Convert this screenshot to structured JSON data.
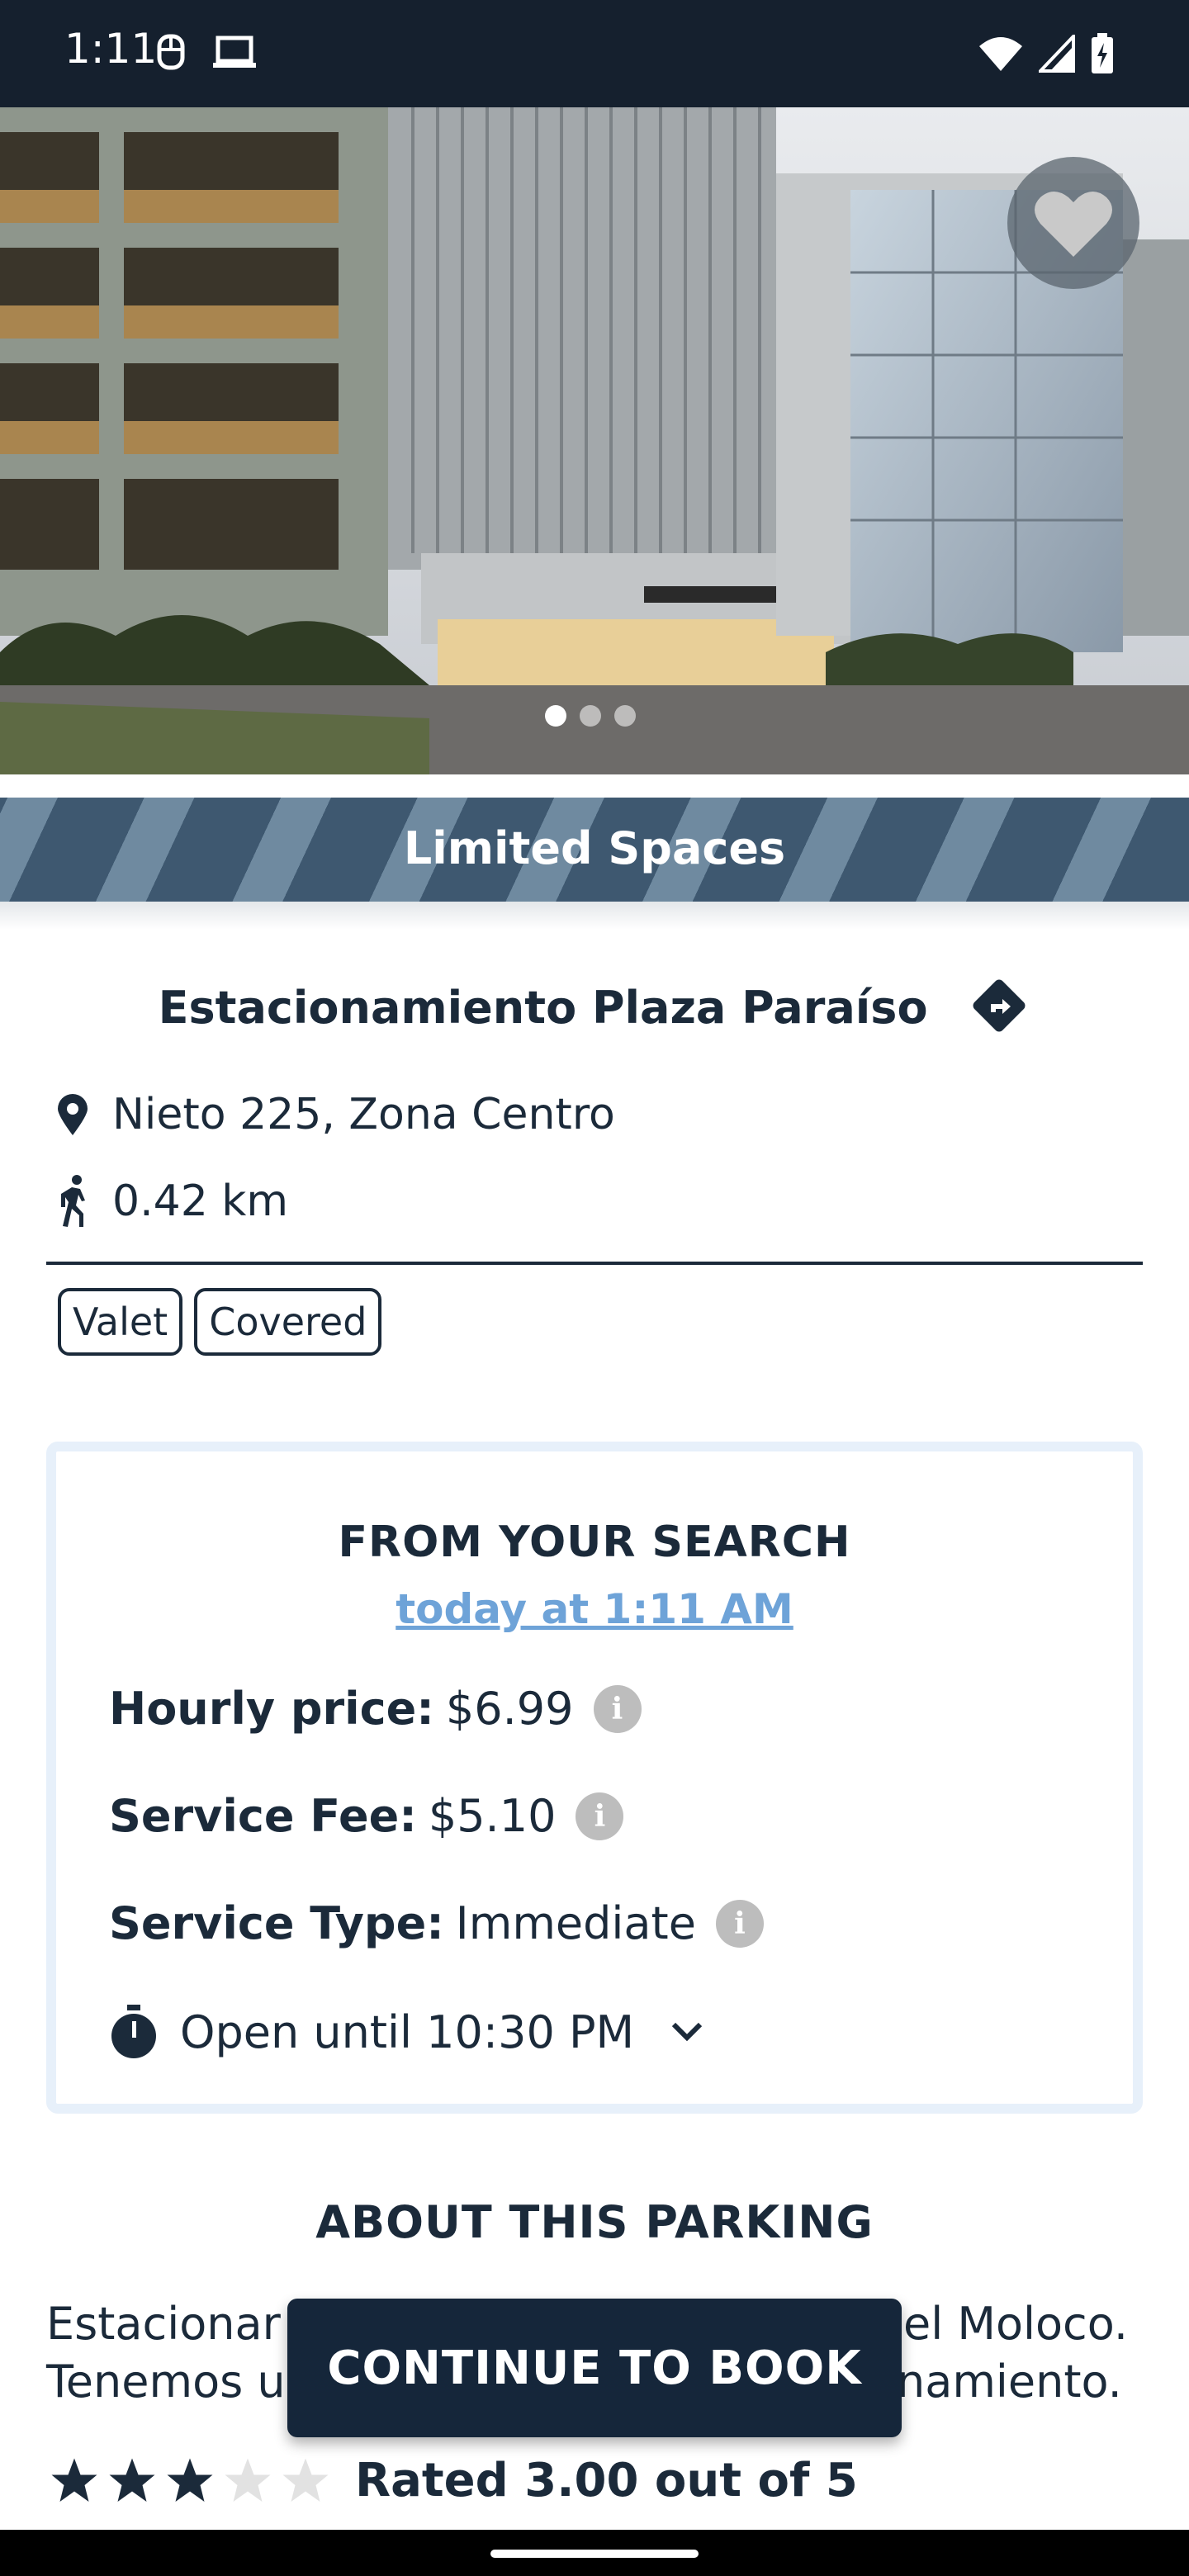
{
  "status_bar": {
    "time": "1:11"
  },
  "hero": {
    "image_count": 3,
    "active_index": 0
  },
  "banner": {
    "text": "Limited Spaces"
  },
  "parking": {
    "name": "Estacionamiento Plaza Paraíso",
    "address": "Nieto 225, Zona Centro",
    "distance": "0.42 km",
    "tags": [
      "Valet",
      "Covered"
    ]
  },
  "search_card": {
    "heading": "FROM YOUR SEARCH",
    "when_link": "today at 1:11 AM ",
    "hourly_price_label": "Hourly price:",
    "hourly_price_value": "$6.99",
    "service_fee_label": "Service Fee:",
    "service_fee_value": "$5.10",
    "service_type_label": "Service Type:",
    "service_type_value": "Immediate",
    "open_until": "Open until 10:30 PM"
  },
  "about": {
    "heading": "ABOUT THIS PARKING",
    "line1_left": "Estacionar",
    "line1_right": "el Moloco.",
    "line2_left": "Tenemos u",
    "line2_right": "namiento."
  },
  "cta": {
    "label": "CONTINUE TO BOOK"
  },
  "rating": {
    "value": 3,
    "max": 5,
    "text": "Rated 3.00 out of 5"
  },
  "colors": {
    "primary_dark": "#15263a",
    "link": "#6ea3d8",
    "card_border": "#e7f0fa"
  }
}
